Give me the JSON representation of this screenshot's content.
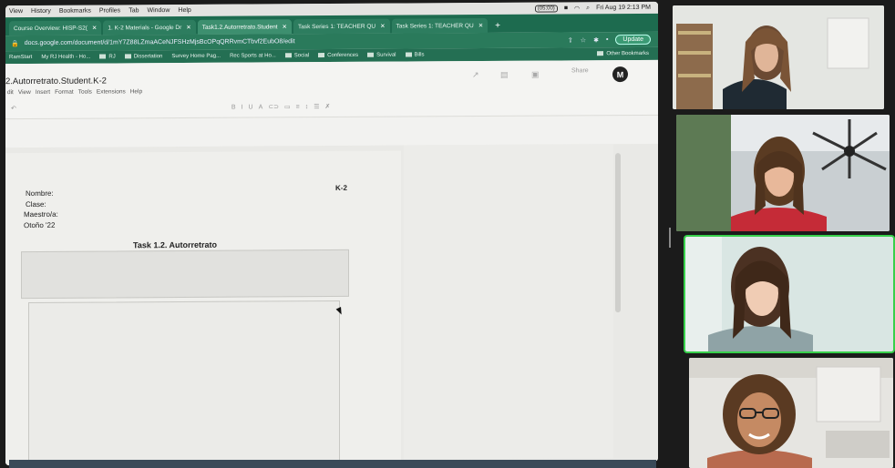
{
  "mac_menu": [
    "View",
    "History",
    "Bookmarks",
    "Profiles",
    "Tab",
    "Window",
    "Help"
  ],
  "status_bar": {
    "volume": "(05:00)",
    "clock": "Fri Aug 19  2:13 PM"
  },
  "browser_tabs": [
    {
      "label": "Course Overview: HISP-S2(",
      "active": false
    },
    {
      "label": "1. K-2 Materials - Google Dr",
      "active": false
    },
    {
      "label": "Task1.2.Autorretrato.Student",
      "active": true
    },
    {
      "label": "Task Series 1: TEACHER QU",
      "active": false
    },
    {
      "label": "Task Series 1: TEACHER QU",
      "active": false
    }
  ],
  "address_bar": {
    "url": "docs.google.com/document/d/1mY7Z88LZmaACeNJFSHzMjsBcOPqQRRvmCTbvf2EubO8/edit",
    "update_label": "Update"
  },
  "bookmarks": [
    "RamStart",
    "My RJ Health - Ho...",
    "RJ",
    "Dissertation",
    "Survey Home Pag...",
    "Rec Sports at Ho...",
    "Social",
    "Conferences",
    "Survival",
    "Bills"
  ],
  "bookmarks_other": "Other Bookmarks",
  "doc": {
    "title": "2.Autorretrato.Student.K-2",
    "menu": [
      "dit",
      "View",
      "Insert",
      "Format",
      "Tools",
      "Extensions",
      "Help"
    ],
    "share_label": "Share",
    "avatar_letter": "M",
    "fields": [
      "Nombre:",
      "Clase:",
      "Maestro/a:",
      "Otoño '22"
    ],
    "grade": "K-2",
    "task_title": "Task 1.2. Autorretrato"
  },
  "colors": {
    "tabs_green": "#1d6b4f",
    "speaker_outline": "#37d04b"
  },
  "video_tiles": [
    "participant-1",
    "participant-2",
    "participant-3-speaking",
    "participant-4"
  ]
}
